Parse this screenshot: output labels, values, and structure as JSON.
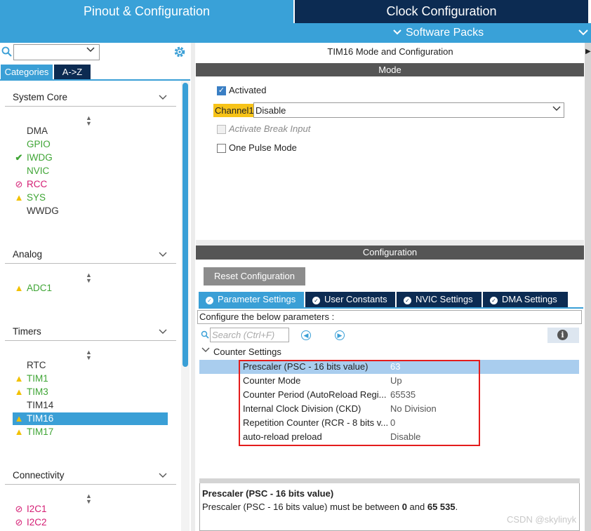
{
  "top_tabs": {
    "pinout": "Pinout & Configuration",
    "clock": "Clock Configuration",
    "software_packs": "Software Packs"
  },
  "left": {
    "category_select_value": "",
    "btn_categories": "Categories",
    "btn_az": "A->Z",
    "sections": {
      "system_core": {
        "title": "System Core",
        "items": [
          {
            "label": "DMA",
            "status": "none",
            "color": "#333333"
          },
          {
            "label": "GPIO",
            "status": "none",
            "color": "#3fa535"
          },
          {
            "label": "IWDG",
            "status": "check",
            "color": "#3fa535"
          },
          {
            "label": "NVIC",
            "status": "none",
            "color": "#3fa535"
          },
          {
            "label": "RCC",
            "status": "ban",
            "color": "#d41c73"
          },
          {
            "label": "SYS",
            "status": "warning",
            "color": "#3fa535"
          },
          {
            "label": "WWDG",
            "status": "none",
            "color": "#333333"
          }
        ]
      },
      "analog": {
        "title": "Analog",
        "items": [
          {
            "label": "ADC1",
            "status": "warning",
            "color": "#3fa535"
          }
        ]
      },
      "timers": {
        "title": "Timers",
        "items": [
          {
            "label": "RTC",
            "status": "none",
            "color": "#333333"
          },
          {
            "label": "TIM1",
            "status": "warning",
            "color": "#3fa535"
          },
          {
            "label": "TIM3",
            "status": "warning",
            "color": "#3fa535"
          },
          {
            "label": "TIM14",
            "status": "none",
            "color": "#333333"
          },
          {
            "label": "TIM16",
            "status": "warning",
            "color": "#ffffff",
            "selected": true
          },
          {
            "label": "TIM17",
            "status": "warning",
            "color": "#3fa535"
          }
        ]
      },
      "connectivity": {
        "title": "Connectivity",
        "items": [
          {
            "label": "I2C1",
            "status": "ban",
            "color": "#d41c73"
          },
          {
            "label": "I2C2",
            "status": "ban",
            "color": "#d41c73"
          }
        ]
      }
    }
  },
  "mode": {
    "panel_title": "TIM16 Mode and Configuration",
    "bar_title": "Mode",
    "activated_label": "Activated",
    "activated_checked": true,
    "channel1_label": "Channel1",
    "channel1_value": "Disable",
    "break_input_label": "Activate Break Input",
    "one_pulse_label": "One Pulse Mode"
  },
  "config": {
    "bar_title": "Configuration",
    "reset_button": "Reset Configuration",
    "tabs": {
      "params": "Parameter Settings",
      "user": "User Constants",
      "nvic": "NVIC Settings",
      "dma": "DMA Settings"
    },
    "hint": "Configure the below parameters :",
    "search_placeholder": "Search (Ctrl+F)",
    "group_label": "Counter Settings",
    "params": [
      {
        "name": "Prescaler (PSC - 16 bits value)",
        "value": "63",
        "selected": true
      },
      {
        "name": "Counter Mode",
        "value": "Up"
      },
      {
        "name": "Counter Period (AutoReload Regi...",
        "value": "65535"
      },
      {
        "name": "Internal Clock Division (CKD)",
        "value": "No Division"
      },
      {
        "name": "Repetition Counter (RCR - 8 bits v...",
        "value": "0"
      },
      {
        "name": "auto-reload preload",
        "value": "Disable"
      }
    ],
    "description": {
      "title": "Prescaler (PSC - 16 bits value)",
      "text_prefix": "Prescaler (PSC - 16 bits value) must be between ",
      "min": "0",
      "text_mid": " and ",
      "max": "65 535",
      "text_suffix": "."
    }
  },
  "watermark": "CSDN @skylinyk",
  "colors": {
    "accent_blue": "#3a9fd6",
    "navy": "#0c2b52",
    "highlight_red": "#e41c1c",
    "channel_yellow": "#f7c318"
  }
}
